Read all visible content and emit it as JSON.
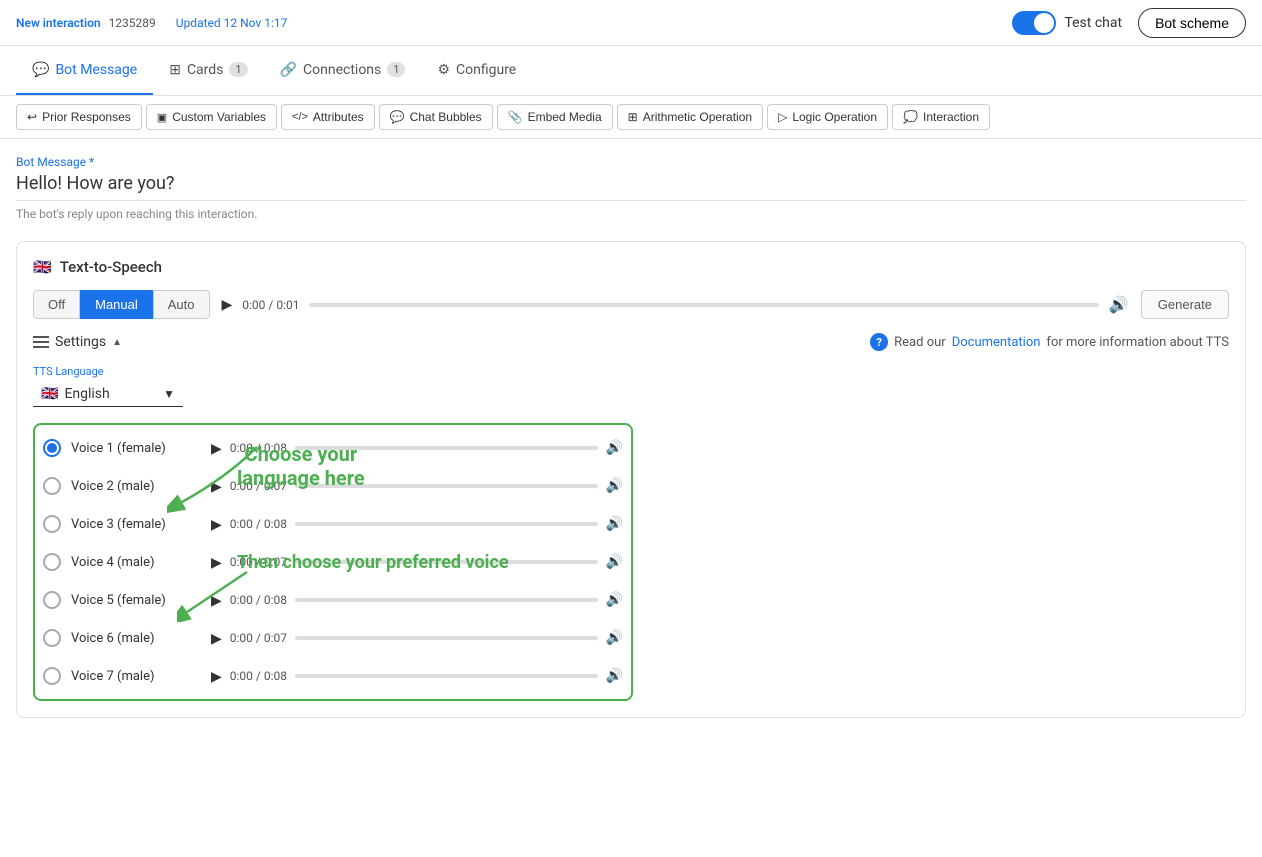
{
  "header": {
    "badge": "New interaction",
    "id": "1235289",
    "updated_label": "Updated",
    "updated_time": "12 Nov 1:17",
    "test_chat_label": "Test chat",
    "bot_scheme_label": "Bot scheme"
  },
  "tabs": [
    {
      "id": "bot-message",
      "label": "Bot Message",
      "icon": "chat",
      "count": null,
      "active": true
    },
    {
      "id": "cards",
      "label": "Cards",
      "icon": "grid",
      "count": "1",
      "active": false
    },
    {
      "id": "connections",
      "label": "Connections",
      "icon": "link",
      "count": "1",
      "active": false
    },
    {
      "id": "configure",
      "label": "Configure",
      "icon": "gear",
      "count": null,
      "active": false
    }
  ],
  "toolbar": {
    "buttons": [
      {
        "id": "prior-responses",
        "label": "Prior Responses",
        "icon": "back"
      },
      {
        "id": "custom-variables",
        "label": "Custom Variables",
        "icon": "var"
      },
      {
        "id": "attributes",
        "label": "Attributes",
        "icon": "attr"
      },
      {
        "id": "chat-bubbles",
        "label": "Chat Bubbles",
        "icon": "bubble"
      },
      {
        "id": "embed-media",
        "label": "Embed Media",
        "icon": "embed"
      },
      {
        "id": "arithmetic-operation",
        "label": "Arithmetic Operation",
        "icon": "math"
      },
      {
        "id": "logic-operation",
        "label": "Logic Operation",
        "icon": "logic"
      },
      {
        "id": "interaction",
        "label": "Interaction",
        "icon": "interact"
      }
    ]
  },
  "bot_message": {
    "field_label": "Bot Message *",
    "field_value": "Hello! How are you?",
    "field_hint": "The bot's reply upon reaching this interaction."
  },
  "tts": {
    "header": "Text-to-Speech",
    "flag": "🇬🇧",
    "modes": [
      "Off",
      "Manual",
      "Auto"
    ],
    "active_mode": "Manual",
    "audio": {
      "time": "0:00 / 0:01",
      "generate_label": "Generate"
    },
    "settings_label": "Settings",
    "docs_prefix": "Read our",
    "docs_link": "Documentation",
    "docs_suffix": "for more information about TTS",
    "language": {
      "label": "TTS Language",
      "value": "English",
      "flag": "🇬🇧"
    },
    "annotation1": "Choose your\nlanguage here",
    "annotation2": "Then choose your preferred voice",
    "voices": [
      {
        "id": "v1",
        "label": "Voice 1 (female)",
        "time": "0:00 / 0:08",
        "selected": true
      },
      {
        "id": "v2",
        "label": "Voice 2 (male)",
        "time": "0:00 / 0:07",
        "selected": false
      },
      {
        "id": "v3",
        "label": "Voice 3 (female)",
        "time": "0:00 / 0:08",
        "selected": false
      },
      {
        "id": "v4",
        "label": "Voice 4 (male)",
        "time": "0:00 / 0:07",
        "selected": false
      },
      {
        "id": "v5",
        "label": "Voice 5 (female)",
        "time": "0:00 / 0:08",
        "selected": false
      },
      {
        "id": "v6",
        "label": "Voice 6 (male)",
        "time": "0:00 / 0:07",
        "selected": false
      },
      {
        "id": "v7",
        "label": "Voice 7 (male)",
        "time": "0:00 / 0:08",
        "selected": false
      }
    ]
  },
  "colors": {
    "blue": "#1a73e8",
    "green": "#4caf50",
    "light_gray": "#f5f5f5",
    "border": "#e0e0e0"
  }
}
